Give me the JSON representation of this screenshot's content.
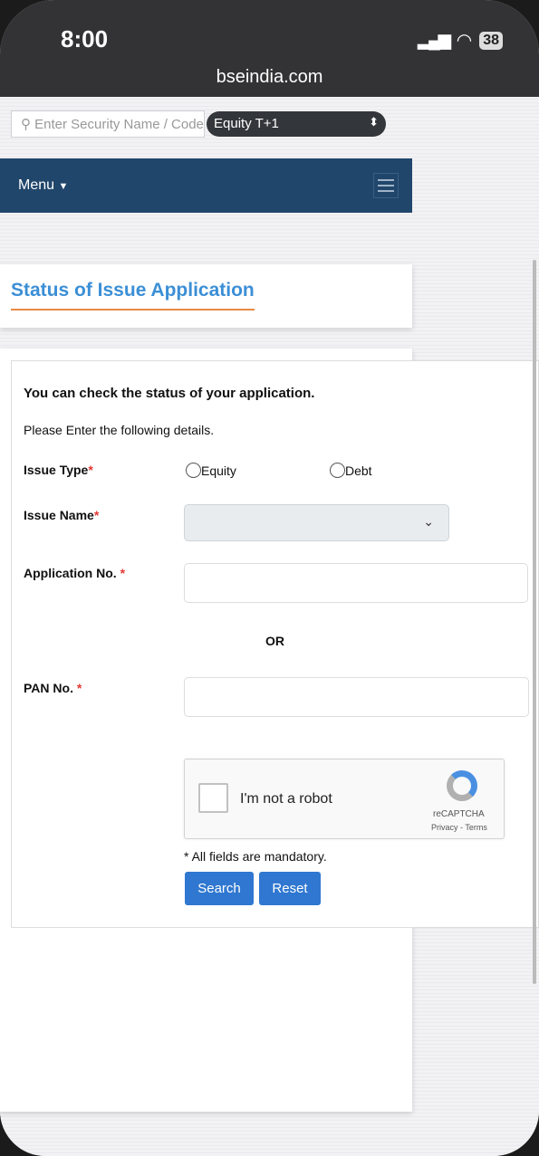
{
  "status_bar": {
    "time": "8:00",
    "battery": "38",
    "url": "bseindia.com"
  },
  "header": {
    "search_placeholder": "Enter Security Name / Code",
    "segment": "Equity T+1",
    "menu_label": "Menu"
  },
  "page_title": "Status of Issue Application",
  "form": {
    "intro": "You can check the status of your application.",
    "instruction": "Please Enter the following details.",
    "issue_type_label": "Issue Type",
    "issue_type_options": [
      "Equity",
      "Debt"
    ],
    "issue_name_label": "Issue Name",
    "issue_name_value": "",
    "application_label": "Application No. ",
    "or": "OR",
    "pan_label": "PAN No. ",
    "required_marker": "*",
    "captcha": {
      "label": "I'm not a robot",
      "brand": "reCAPTCHA",
      "privacy": "Privacy",
      "sep": " - ",
      "terms": "Terms"
    },
    "mandatory_note": "* All fields are mandatory.",
    "search_button": "Search",
    "reset_button": "Reset"
  },
  "colors": {
    "nav": "#21466b",
    "title": "#3b8fd6",
    "underline": "#e98a45",
    "button": "#2f77d0",
    "required": "#e53935"
  }
}
